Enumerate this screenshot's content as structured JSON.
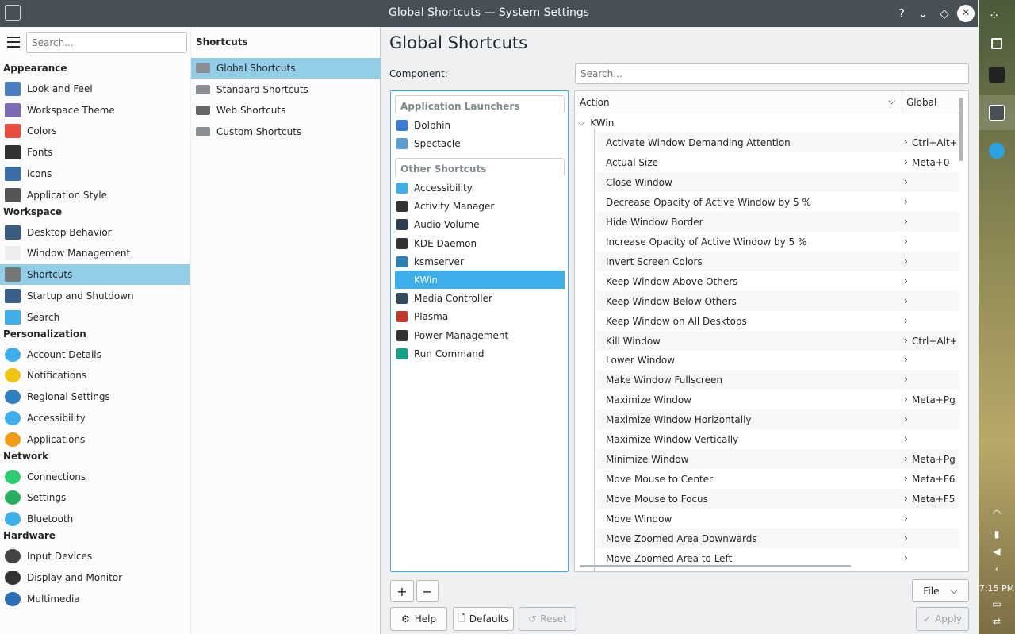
{
  "window": {
    "title": "Global Shortcuts — System Settings"
  },
  "sidebar": {
    "search_placeholder": "Search...",
    "sections": [
      {
        "title": "Appearance",
        "items": [
          "Look and Feel",
          "Workspace Theme",
          "Colors",
          "Fonts",
          "Icons",
          "Application Style"
        ]
      },
      {
        "title": "Workspace",
        "items": [
          "Desktop Behavior",
          "Window Management",
          "Shortcuts",
          "Startup and Shutdown",
          "Search"
        ]
      },
      {
        "title": "Personalization",
        "items": [
          "Account Details",
          "Notifications",
          "Regional Settings",
          "Accessibility",
          "Applications"
        ]
      },
      {
        "title": "Network",
        "items": [
          "Connections",
          "Settings",
          "Bluetooth"
        ]
      },
      {
        "title": "Hardware",
        "items": [
          "Input Devices",
          "Display and Monitor",
          "Multimedia"
        ]
      }
    ],
    "selected": "Shortcuts"
  },
  "middle": {
    "header": "Shortcuts",
    "items": [
      "Global Shortcuts",
      "Standard Shortcuts",
      "Web Shortcuts",
      "Custom Shortcuts"
    ],
    "selected": "Global Shortcuts"
  },
  "main": {
    "title": "Global Shortcuts",
    "component_label": "Component:",
    "search_placeholder": "Search...",
    "groups": [
      {
        "title": "Application Launchers",
        "items": [
          "Dolphin",
          "Spectacle"
        ]
      },
      {
        "title": "Other Shortcuts",
        "items": [
          "Accessibility",
          "Activity Manager",
          "Audio Volume",
          "KDE Daemon",
          "ksmserver",
          "KWin",
          "Media Controller",
          "Plasma",
          "Power Management",
          "Run Command"
        ]
      }
    ],
    "selected_component": "KWin",
    "table": {
      "col_action": "Action",
      "col_global": "Global",
      "root": "KWin",
      "rows": [
        {
          "action": "Activate Window Demanding Attention",
          "key": "Ctrl+Alt+A"
        },
        {
          "action": "Actual Size",
          "key": "Meta+0"
        },
        {
          "action": "Close Window",
          "key": ""
        },
        {
          "action": "Decrease Opacity of Active Window by 5 %",
          "key": ""
        },
        {
          "action": "Hide Window Border",
          "key": ""
        },
        {
          "action": "Increase Opacity of Active Window by 5 %",
          "key": ""
        },
        {
          "action": "Invert Screen Colors",
          "key": ""
        },
        {
          "action": "Keep Window Above Others",
          "key": ""
        },
        {
          "action": "Keep Window Below Others",
          "key": ""
        },
        {
          "action": "Keep Window on All Desktops",
          "key": ""
        },
        {
          "action": "Kill Window",
          "key": "Ctrl+Alt+Esc"
        },
        {
          "action": "Lower Window",
          "key": ""
        },
        {
          "action": "Make Window Fullscreen",
          "key": ""
        },
        {
          "action": "Maximize Window",
          "key": "Meta+PgUp"
        },
        {
          "action": "Maximize Window Horizontally",
          "key": ""
        },
        {
          "action": "Maximize Window Vertically",
          "key": ""
        },
        {
          "action": "Minimize Window",
          "key": "Meta+PgDown"
        },
        {
          "action": "Move Mouse to Center",
          "key": "Meta+F6"
        },
        {
          "action": "Move Mouse to Focus",
          "key": "Meta+F5"
        },
        {
          "action": "Move Window",
          "key": ""
        },
        {
          "action": "Move Zoomed Area Downwards",
          "key": ""
        },
        {
          "action": "Move Zoomed Area to Left",
          "key": ""
        }
      ]
    }
  },
  "buttons": {
    "add": "+",
    "remove": "−",
    "file": "File",
    "help": "Help",
    "defaults": "Defaults",
    "reset": "Reset",
    "apply": "Apply"
  },
  "panel": {
    "clock": "7:15 PM"
  }
}
